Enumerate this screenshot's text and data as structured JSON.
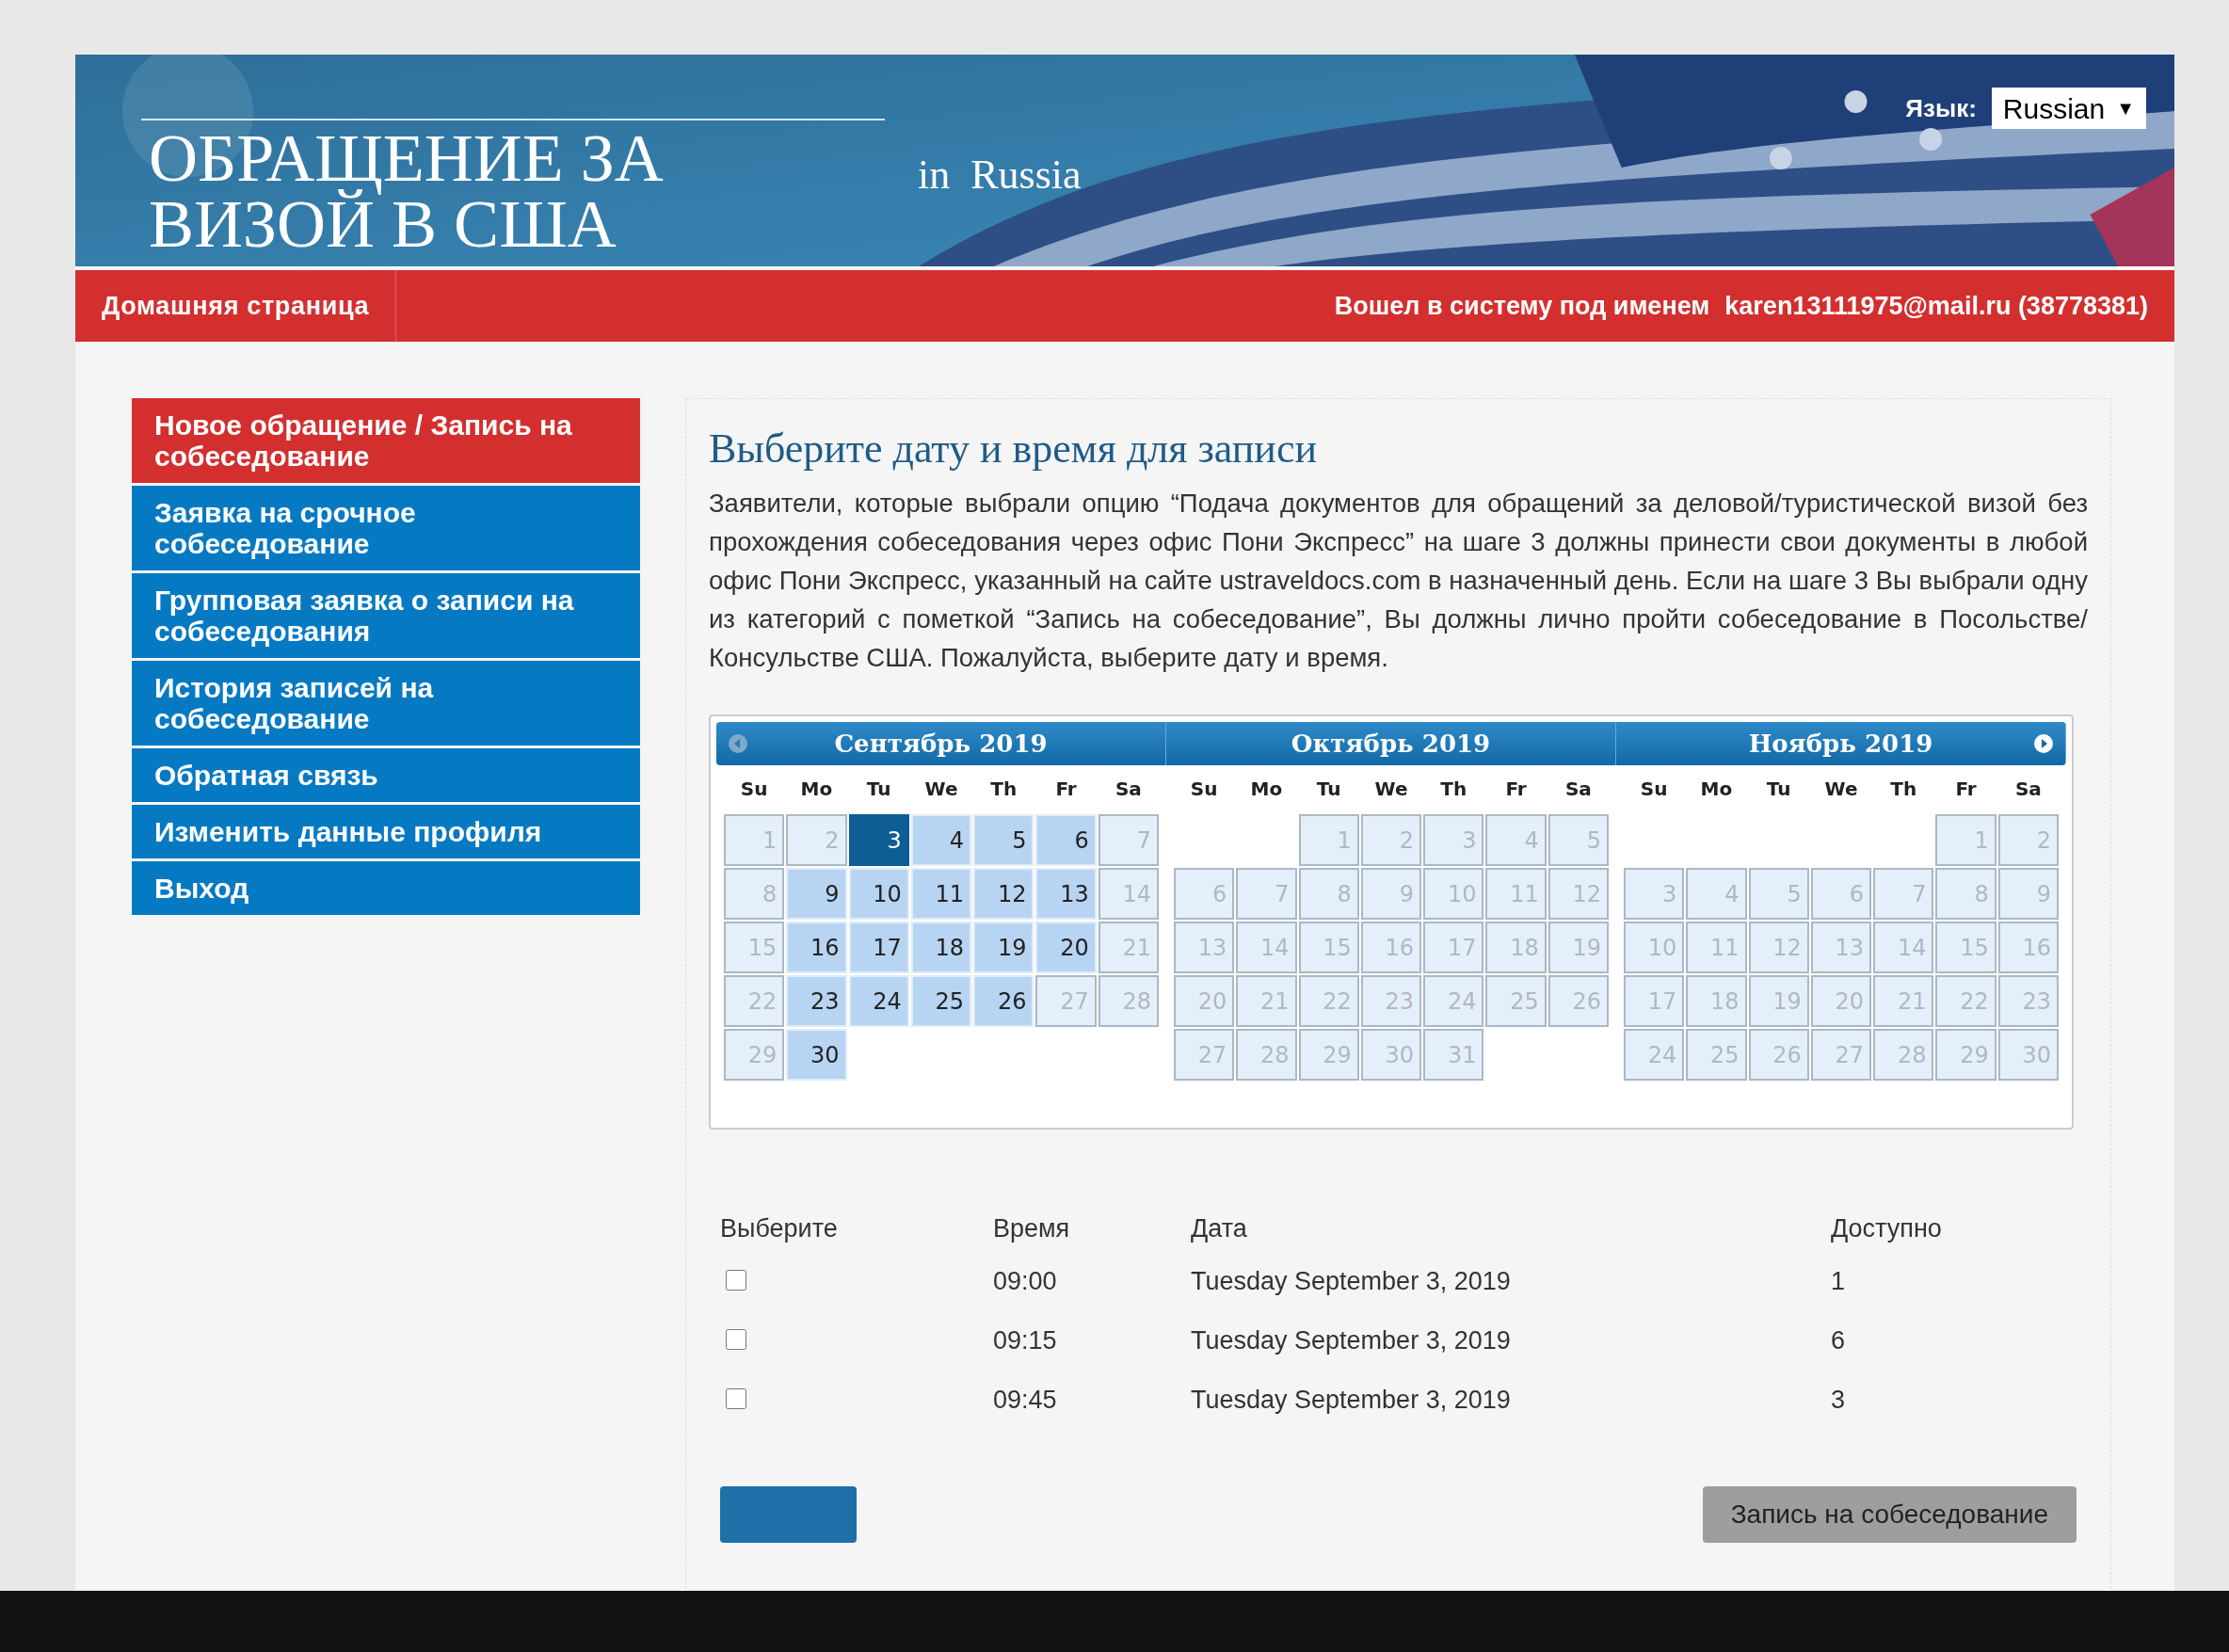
{
  "header": {
    "title_line_1": "ОБРАЩЕНИЕ ЗА",
    "title_line_2": "ВИЗОЙ В США",
    "country": "in  Russia",
    "language_label": "Язык:",
    "language_value": "Russian",
    "language_caret": "▼"
  },
  "nav_bar": {
    "home": "Домашняя страница",
    "logged_in_label": "Вошел в систему под именем",
    "user": "karen13111975@mail.ru (38778381)"
  },
  "sidebar": {
    "items": [
      {
        "label": "Новое обращение / Запись на собеседование",
        "selected": true
      },
      {
        "label": "Заявка на срочное собеседование",
        "selected": false
      },
      {
        "label": "Групповая заявка о записи на собеседования",
        "selected": false
      },
      {
        "label": "История записей на собеседование",
        "selected": false
      },
      {
        "label": "Обратная связь",
        "selected": false
      },
      {
        "label": "Изменить данные профиля",
        "selected": false
      },
      {
        "label": "Выход",
        "selected": false
      }
    ]
  },
  "main": {
    "heading": "Выберите дату и время для записи",
    "intro": "Заявители, которые выбрали опцию “Подача документов для обращений за деловой/туристической визой без прохождения собеседования через офис Пони Экспресс” на шаге 3 должны принести свои документы в любой офис Пони Экспресс, указанный на сайте ustraveldocs.com в назначенный день. Если на шаге 3 Вы выбрали одну из категорий с пометкой “Запись на собеседование”, Вы должны лично пройти собеседование в Посольстве/Консульстве США. Пожалуйста, выберите дату и время.",
    "calendar": {
      "months": [
        {
          "title": "Сентябрь 2019",
          "weekdays": [
            "Su",
            "Mo",
            "Tu",
            "We",
            "Th",
            "Fr",
            "Sa"
          ],
          "weeks": [
            [
              {
                "day": "1",
                "available": false,
                "selected": false
              },
              {
                "day": "2",
                "available": false,
                "selected": false
              },
              {
                "day": "3",
                "available": true,
                "selected": true
              },
              {
                "day": "4",
                "available": true,
                "selected": false
              },
              {
                "day": "5",
                "available": true,
                "selected": false
              },
              {
                "day": "6",
                "available": true,
                "selected": false
              },
              {
                "day": "7",
                "available": false,
                "selected": false
              }
            ],
            [
              {
                "day": "8",
                "available": false,
                "selected": false
              },
              {
                "day": "9",
                "available": true,
                "selected": false
              },
              {
                "day": "10",
                "available": true,
                "selected": false
              },
              {
                "day": "11",
                "available": true,
                "selected": false
              },
              {
                "day": "12",
                "available": true,
                "selected": false
              },
              {
                "day": "13",
                "available": true,
                "selected": false
              },
              {
                "day": "14",
                "available": false,
                "selected": false
              }
            ],
            [
              {
                "day": "15",
                "available": false,
                "selected": false
              },
              {
                "day": "16",
                "available": true,
                "selected": false
              },
              {
                "day": "17",
                "available": true,
                "selected": false
              },
              {
                "day": "18",
                "available": true,
                "selected": false
              },
              {
                "day": "19",
                "available": true,
                "selected": false
              },
              {
                "day": "20",
                "available": true,
                "selected": false
              },
              {
                "day": "21",
                "available": false,
                "selected": false
              }
            ],
            [
              {
                "day": "22",
                "available": false,
                "selected": false
              },
              {
                "day": "23",
                "available": true,
                "selected": false
              },
              {
                "day": "24",
                "available": true,
                "selected": false
              },
              {
                "day": "25",
                "available": true,
                "selected": false
              },
              {
                "day": "26",
                "available": true,
                "selected": false
              },
              {
                "day": "27",
                "available": false,
                "selected": false
              },
              {
                "day": "28",
                "available": false,
                "selected": false
              }
            ],
            [
              {
                "day": "29",
                "available": false,
                "selected": false
              },
              {
                "day": "30",
                "available": true,
                "selected": false
              }
            ]
          ]
        },
        {
          "title": "Октябрь 2019",
          "weekdays": [
            "Su",
            "Mo",
            "Tu",
            "We",
            "Th",
            "Fr",
            "Sa"
          ],
          "weeks": [
            [
              {
                "day": "1",
                "available": false,
                "selected": false
              },
              {
                "day": "2",
                "available": false,
                "selected": false
              },
              {
                "day": "3",
                "available": false,
                "selected": false
              },
              {
                "day": "4",
                "available": false,
                "selected": false
              },
              {
                "day": "5",
                "available": false,
                "selected": false
              }
            ],
            [
              {
                "day": "6",
                "available": false,
                "selected": false
              },
              {
                "day": "7",
                "available": false,
                "selected": false
              },
              {
                "day": "8",
                "available": false,
                "selected": false
              },
              {
                "day": "9",
                "available": false,
                "selected": false
              },
              {
                "day": "10",
                "available": false,
                "selected": false
              },
              {
                "day": "11",
                "available": false,
                "selected": false
              },
              {
                "day": "12",
                "available": false,
                "selected": false
              }
            ],
            [
              {
                "day": "13",
                "available": false,
                "selected": false
              },
              {
                "day": "14",
                "available": false,
                "selected": false
              },
              {
                "day": "15",
                "available": false,
                "selected": false
              },
              {
                "day": "16",
                "available": false,
                "selected": false
              },
              {
                "day": "17",
                "available": false,
                "selected": false
              },
              {
                "day": "18",
                "available": false,
                "selected": false
              },
              {
                "day": "19",
                "available": false,
                "selected": false
              }
            ],
            [
              {
                "day": "20",
                "available": false,
                "selected": false
              },
              {
                "day": "21",
                "available": false,
                "selected": false
              },
              {
                "day": "22",
                "available": false,
                "selected": false
              },
              {
                "day": "23",
                "available": false,
                "selected": false
              },
              {
                "day": "24",
                "available": false,
                "selected": false
              },
              {
                "day": "25",
                "available": false,
                "selected": false
              },
              {
                "day": "26",
                "available": false,
                "selected": false
              }
            ],
            [
              {
                "day": "27",
                "available": false,
                "selected": false
              },
              {
                "day": "28",
                "available": false,
                "selected": false
              },
              {
                "day": "29",
                "available": false,
                "selected": false
              },
              {
                "day": "30",
                "available": false,
                "selected": false
              },
              {
                "day": "31",
                "available": false,
                "selected": false
              }
            ]
          ]
        },
        {
          "title": "Ноябрь 2019",
          "weekdays": [
            "Su",
            "Mo",
            "Tu",
            "We",
            "Th",
            "Fr",
            "Sa"
          ],
          "weeks": [
            [
              {
                "day": "1",
                "available": false,
                "selected": false
              },
              {
                "day": "2",
                "available": false,
                "selected": false
              }
            ],
            [
              {
                "day": "3",
                "available": false,
                "selected": false
              },
              {
                "day": "4",
                "available": false,
                "selected": false
              },
              {
                "day": "5",
                "available": false,
                "selected": false
              },
              {
                "day": "6",
                "available": false,
                "selected": false
              },
              {
                "day": "7",
                "available": false,
                "selected": false
              },
              {
                "day": "8",
                "available": false,
                "selected": false
              },
              {
                "day": "9",
                "available": false,
                "selected": false
              }
            ],
            [
              {
                "day": "10",
                "available": false,
                "selected": false
              },
              {
                "day": "11",
                "available": false,
                "selected": false
              },
              {
                "day": "12",
                "available": false,
                "selected": false
              },
              {
                "day": "13",
                "available": false,
                "selected": false
              },
              {
                "day": "14",
                "available": false,
                "selected": false
              },
              {
                "day": "15",
                "available": false,
                "selected": false
              },
              {
                "day": "16",
                "available": false,
                "selected": false
              }
            ],
            [
              {
                "day": "17",
                "available": false,
                "selected": false
              },
              {
                "day": "18",
                "available": false,
                "selected": false
              },
              {
                "day": "19",
                "available": false,
                "selected": false
              },
              {
                "day": "20",
                "available": false,
                "selected": false
              },
              {
                "day": "21",
                "available": false,
                "selected": false
              },
              {
                "day": "22",
                "available": false,
                "selected": false
              },
              {
                "day": "23",
                "available": false,
                "selected": false
              }
            ],
            [
              {
                "day": "24",
                "available": false,
                "selected": false
              },
              {
                "day": "25",
                "available": false,
                "selected": false
              },
              {
                "day": "26",
                "available": false,
                "selected": false
              },
              {
                "day": "27",
                "available": false,
                "selected": false
              },
              {
                "day": "28",
                "available": false,
                "selected": false
              },
              {
                "day": "29",
                "available": false,
                "selected": false
              },
              {
                "day": "30",
                "available": false,
                "selected": false
              }
            ]
          ]
        }
      ]
    },
    "slots": {
      "columns": [
        "Выберите",
        "Время",
        "Дата",
        "Доступно"
      ],
      "rows": [
        {
          "checked": false,
          "time": "09:00",
          "date": "Tuesday September 3, 2019",
          "available": "1"
        },
        {
          "checked": false,
          "time": "09:15",
          "date": "Tuesday September 3, 2019",
          "available": "6"
        },
        {
          "checked": false,
          "time": "09:45",
          "date": "Tuesday September 3, 2019",
          "available": "3"
        }
      ]
    },
    "submit_button": "Запись на собеседование"
  }
}
